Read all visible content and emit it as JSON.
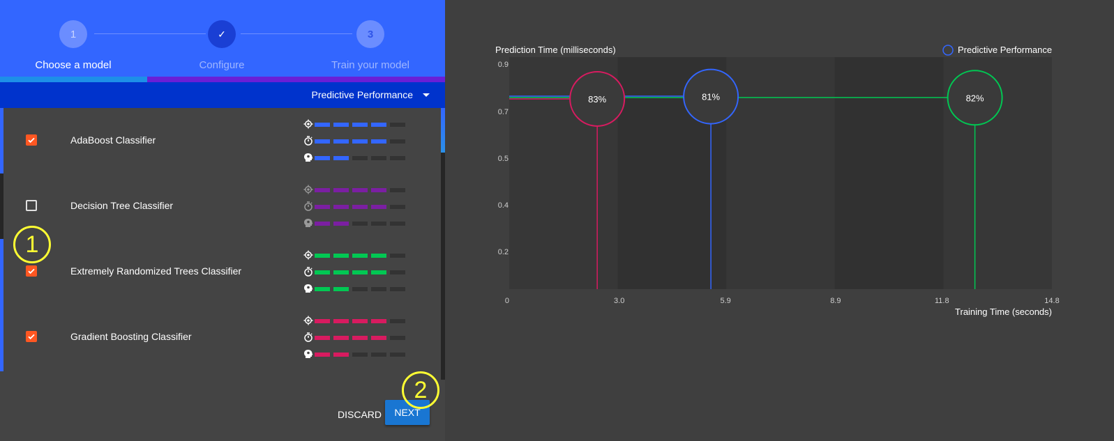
{
  "stepper": {
    "steps": [
      {
        "number": "1",
        "label": "Choose a model"
      },
      {
        "number": "✓",
        "label": "Configure"
      },
      {
        "number": "3",
        "label": "Train your model"
      }
    ],
    "progress": 0.33
  },
  "sort": {
    "label": "Predictive Performance"
  },
  "models": [
    {
      "name": "AdaBoost Classifier",
      "checked": true,
      "color": "#3366ff",
      "metrics": {
        "performance": 4,
        "prediction_time": 4,
        "training_time": 2
      }
    },
    {
      "name": "Decision Tree Classifier",
      "checked": false,
      "color": "#7b1fa2",
      "metrics": {
        "performance": 4,
        "prediction_time": 4,
        "training_time": 2
      }
    },
    {
      "name": "Extremely Randomized Trees Classifier",
      "checked": true,
      "color": "#00c853",
      "metrics": {
        "performance": 4,
        "prediction_time": 4,
        "training_time": 2
      }
    },
    {
      "name": "Gradient Boosting Classifier",
      "checked": true,
      "color": "#d81b60",
      "metrics": {
        "performance": 4,
        "prediction_time": 4,
        "training_time": 2
      }
    }
  ],
  "icons": {
    "performance": "crosshair-icon",
    "prediction_time": "stopwatch-icon",
    "training_time": "brain-head-icon"
  },
  "actions": {
    "discard_label": "DISCARD",
    "next_label": "NEXT"
  },
  "callouts": [
    "1",
    "2"
  ],
  "chart_data": {
    "type": "scatter",
    "ylabel": "Prediction Time (milliseconds)",
    "xlabel": "Training Time (seconds)",
    "legend": {
      "label": "Predictive Performance",
      "placement": "top-right"
    },
    "x_ticks": [
      "0",
      "3.0",
      "5.9",
      "8.9",
      "11.8",
      "14.8"
    ],
    "y_ticks": [
      "0.9",
      "0.7",
      "0.5",
      "0.4",
      "0.2"
    ],
    "xlim": [
      0,
      14.8
    ],
    "ylim": [
      0,
      1.0
    ],
    "points": [
      {
        "x": 2.4,
        "y": 0.82,
        "label": "83%",
        "color": "#d81b60"
      },
      {
        "x": 5.5,
        "y": 0.83,
        "label": "81%",
        "color": "#3366ff"
      },
      {
        "x": 12.7,
        "y": 0.825,
        "label": "82%",
        "color": "#00c853"
      }
    ]
  }
}
